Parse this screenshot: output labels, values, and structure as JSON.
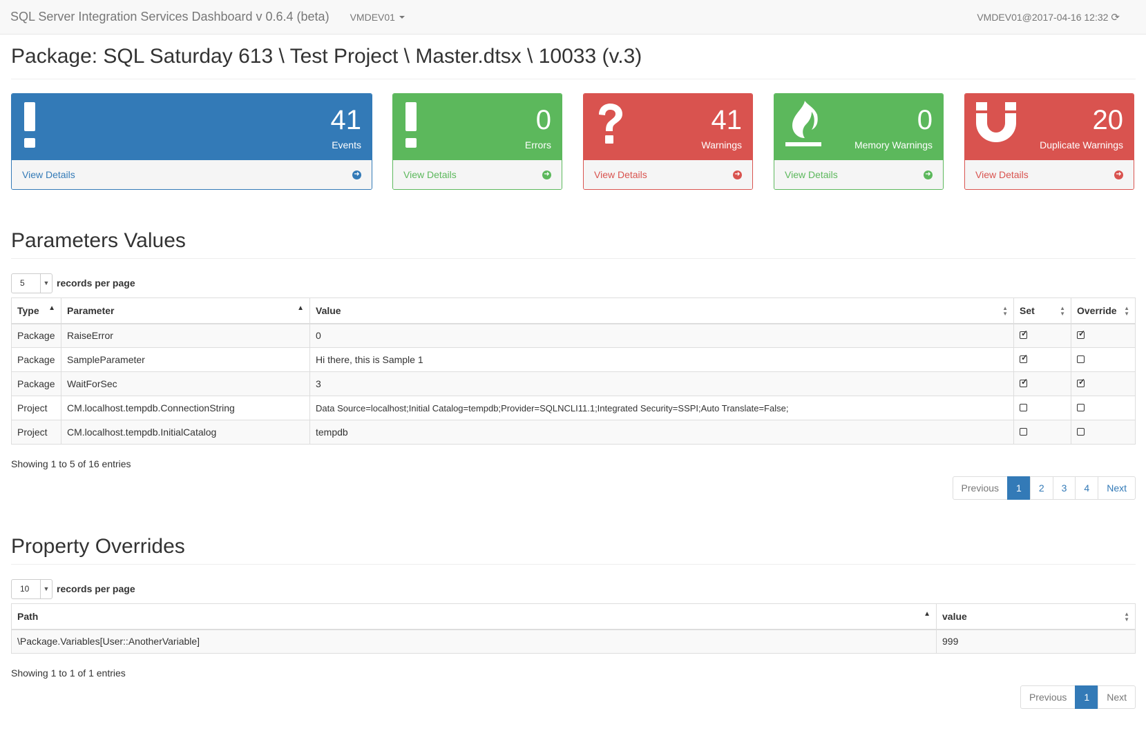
{
  "navbar": {
    "brand": "SQL Server Integration Services Dashboard v 0.6.4 (beta)",
    "server": "VMDEV01",
    "server_time": "VMDEV01@2017-04-16 12:32"
  },
  "page_title": "Package: SQL Saturday 613 \\ Test Project \\ Master.dtsx \\ 10033 (v.3)",
  "colors": {
    "primary": "#337ab7",
    "success": "#5cb85c",
    "danger": "#d9534f"
  },
  "panels": [
    {
      "count": "41",
      "label": "Events",
      "footer": "View Details",
      "color": "primary",
      "icon": "exclamation-icon"
    },
    {
      "count": "0",
      "label": "Errors",
      "footer": "View Details",
      "color": "success",
      "icon": "exclamation-icon"
    },
    {
      "count": "41",
      "label": "Warnings",
      "footer": "View Details",
      "color": "danger",
      "icon": "question-icon"
    },
    {
      "count": "0",
      "label": "Memory Warnings",
      "footer": "View Details",
      "color": "success",
      "icon": "fire-icon"
    },
    {
      "count": "20",
      "label": "Duplicate Warnings",
      "footer": "View Details",
      "color": "danger",
      "icon": "magnet-icon"
    }
  ],
  "parameters": {
    "title": "Parameters Values",
    "page_length": "5",
    "page_length_label": "records per page",
    "columns": [
      "Type",
      "Parameter",
      "Value",
      "Set",
      "Override"
    ],
    "rows": [
      {
        "type": "Package",
        "parameter": "RaiseError",
        "value": "0",
        "set": true,
        "override": true
      },
      {
        "type": "Package",
        "parameter": "SampleParameter",
        "value": "Hi there, this is Sample 1",
        "set": true,
        "override": false
      },
      {
        "type": "Package",
        "parameter": "WaitForSec",
        "value": "3",
        "set": true,
        "override": true
      },
      {
        "type": "Project",
        "parameter": "CM.localhost.tempdb.ConnectionString",
        "value": "Data Source=localhost;Initial Catalog=tempdb;Provider=SQLNCLI11.1;Integrated Security=SSPI;Auto Translate=False;",
        "set": false,
        "override": false
      },
      {
        "type": "Project",
        "parameter": "CM.localhost.tempdb.InitialCatalog",
        "value": "tempdb",
        "set": false,
        "override": false
      }
    ],
    "info": "Showing 1 to 5 of 16 entries",
    "pager": {
      "previous": "Previous",
      "pages": [
        "1",
        "2",
        "3",
        "4"
      ],
      "next": "Next",
      "active": "1"
    }
  },
  "overrides": {
    "title": "Property Overrides",
    "page_length": "10",
    "page_length_label": "records per page",
    "columns": [
      "Path",
      "value"
    ],
    "rows": [
      {
        "path": "\\Package.Variables[User::AnotherVariable]",
        "value": "999"
      }
    ],
    "info": "Showing 1 to 1 of 1 entries",
    "pager": {
      "previous": "Previous",
      "pages": [
        "1"
      ],
      "next": "Next",
      "active": "1"
    }
  }
}
